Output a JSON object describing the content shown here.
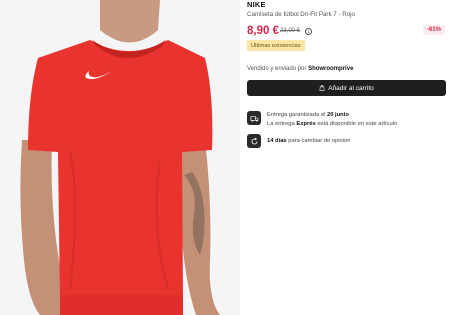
{
  "product": {
    "brand": "NIKE",
    "name": "Camiseta de fútbol Dri-Fit Park 7 - Rojo",
    "price": "8,90 €",
    "old_price": "23,00 €",
    "discount": "-61%",
    "stock_badge": "Últimas existencias"
  },
  "seller": {
    "prefix": "Vendido y enviado por",
    "name": "Showroomprive"
  },
  "actions": {
    "add_to_cart": "Añadir al carrito"
  },
  "delivery": {
    "line1_prefix": "Entrega garantizada el",
    "line1_date": "20 junio",
    "line2_prefix": "La entrega",
    "line2_bold": "Exprés",
    "line2_suffix": "está disponible en este artículo"
  },
  "returns": {
    "days": "14 días",
    "text": "para cambiar de opinión"
  },
  "colors": {
    "accent": "#d7254a",
    "button": "#1f1f1f",
    "badge_bg": "#fbe6a5",
    "shirt": "#e8332f"
  },
  "icons": {
    "info": "info-icon",
    "bag": "shopping-bag-icon",
    "delivery": "delivery-truck-icon",
    "returns": "return-arrow-icon",
    "logo": "nike-swoosh-icon"
  }
}
